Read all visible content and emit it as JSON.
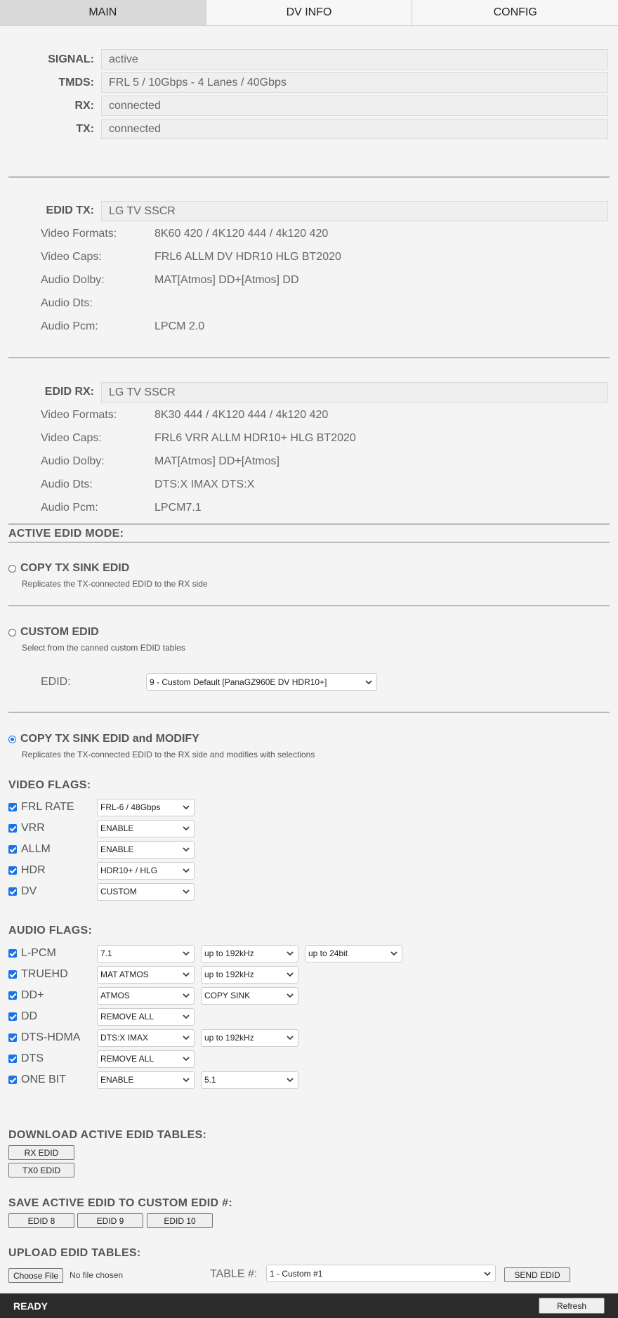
{
  "tabs": [
    {
      "label": "MAIN",
      "active": true
    },
    {
      "label": "DV INFO",
      "active": false
    },
    {
      "label": "CONFIG",
      "active": false
    }
  ],
  "status": {
    "signal_label": "SIGNAL:",
    "signal": "active",
    "tmds_label": "TMDS:",
    "tmds": "FRL 5 / 10Gbps - 4 Lanes / 40Gbps",
    "rx_label": "RX:",
    "rx": "connected",
    "tx_label": "TX:",
    "tx": "connected"
  },
  "edid_tx": {
    "label": "EDID TX:",
    "name": "LG TV SSCR",
    "rows": [
      {
        "k": "Video Formats:",
        "v": "8K60 420 / 4K120 444 / 4k120 420"
      },
      {
        "k": "Video Caps:",
        "v": "FRL6 ALLM DV HDR10 HLG BT2020"
      },
      {
        "k": "Audio Dolby:",
        "v": "MAT[Atmos] DD+[Atmos] DD"
      },
      {
        "k": "Audio Dts:",
        "v": ""
      },
      {
        "k": "Audio Pcm:",
        "v": "LPCM 2.0"
      }
    ]
  },
  "edid_rx": {
    "label": "EDID RX:",
    "name": "LG TV SSCR",
    "rows": [
      {
        "k": "Video Formats:",
        "v": "8K30 444 / 4K120 444 / 4k120 420"
      },
      {
        "k": "Video Caps:",
        "v": "FRL6 VRR ALLM HDR10+ HLG BT2020"
      },
      {
        "k": "Audio Dolby:",
        "v": "MAT[Atmos] DD+[Atmos]"
      },
      {
        "k": "Audio Dts:",
        "v": "DTS:X IMAX DTS:X"
      },
      {
        "k": "Audio Pcm:",
        "v": "LPCM7.1"
      }
    ]
  },
  "mode": {
    "heading": "ACTIVE EDID MODE:",
    "copy_title": "COPY TX SINK EDID",
    "copy_desc": "Replicates the TX-connected EDID to the RX side",
    "custom_title": "CUSTOM EDID",
    "custom_desc": "Select from the canned custom EDID tables",
    "edid_label": "EDID:",
    "edid_value": "9 - Custom Default [PanaGZ960E DV HDR10+]",
    "modify_title": "COPY TX SINK EDID and MODIFY",
    "modify_desc": "Replicates the TX-connected EDID to the RX side and modifies with selections",
    "selected": "modify"
  },
  "video_flags": {
    "heading": "VIDEO FLAGS:",
    "rows": [
      {
        "label": "FRL RATE",
        "v1": "FRL-6 / 48Gbps"
      },
      {
        "label": "VRR",
        "v1": "ENABLE"
      },
      {
        "label": "ALLM",
        "v1": "ENABLE"
      },
      {
        "label": "HDR",
        "v1": "HDR10+ / HLG"
      },
      {
        "label": "DV",
        "v1": "CUSTOM"
      }
    ]
  },
  "audio_flags": {
    "heading": "AUDIO FLAGS:",
    "rows": [
      {
        "label": "L-PCM",
        "v1": "7.1",
        "v2": "up to 192kHz",
        "v3": "up to 24bit"
      },
      {
        "label": "TRUEHD",
        "v1": "MAT ATMOS",
        "v2": "up to 192kHz"
      },
      {
        "label": "DD+",
        "v1": "ATMOS",
        "v2": "COPY SINK"
      },
      {
        "label": "DD",
        "v1": "REMOVE ALL"
      },
      {
        "label": "DTS-HDMA",
        "v1": "DTS:X IMAX",
        "v2": "up to 192kHz"
      },
      {
        "label": "DTS",
        "v1": "REMOVE ALL"
      },
      {
        "label": "ONE BIT",
        "v1": "ENABLE",
        "v2": "5.1"
      }
    ]
  },
  "download": {
    "heading": "DOWNLOAD ACTIVE EDID TABLES:",
    "rx": "RX EDID",
    "tx0": "TX0 EDID"
  },
  "save": {
    "heading": "SAVE ACTIVE EDID TO CUSTOM EDID #:",
    "b8": "EDID 8",
    "b9": "EDID 9",
    "b10": "EDID 10"
  },
  "upload": {
    "heading": "UPLOAD EDID TABLES:",
    "choose": "Choose File",
    "no_file": "No file chosen",
    "table_label": "TABLE #:",
    "table_value": "1 - Custom #1",
    "send": "SEND EDID"
  },
  "footer": {
    "status": "READY",
    "refresh": "Refresh"
  },
  "colors": {
    "accent": "#1a73e8",
    "status_bar": "#2b2b2b"
  }
}
